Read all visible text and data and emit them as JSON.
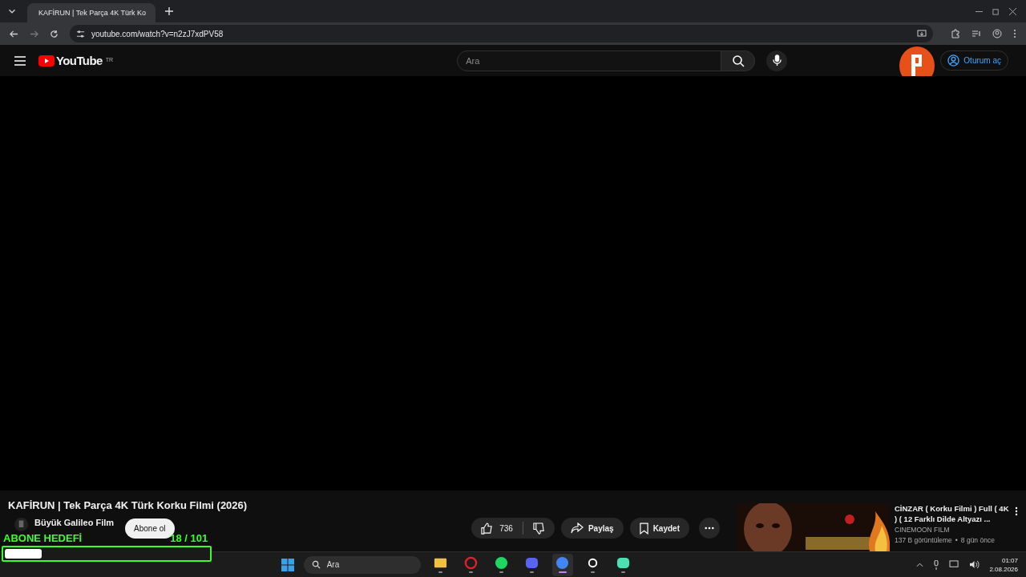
{
  "browser": {
    "tab_title": "KAFİRUN | Tek Parça 4K Türk Ko",
    "url": "youtube.com/watch?v=n2zJ7xdPV58"
  },
  "header": {
    "logo": "YouTube",
    "region": "TR",
    "search_placeholder": "Ara",
    "sign_in": "Oturum aç"
  },
  "video": {
    "title": "KAFİRUN | Tek Parça 4K Türk Korku Filmi (2026)",
    "channel": "Büyük Galileo Film",
    "subscribe": "Abone ol",
    "likes": "736",
    "share": "Paylaş",
    "save": "Kaydet"
  },
  "recommended": [
    {
      "title": "CİNZAR ( Korku Filmi ) Full ( 4K ) ( 12 Farklı Dilde Altyazı ...",
      "channel": "CINEMOON FILM",
      "views": "137 B görüntüleme",
      "separator": "•",
      "age": "8 gün önce"
    }
  ],
  "overlay": {
    "label": "ABONE HEDEFİ",
    "count": "18 / 101",
    "level": 0.18
  },
  "taskbar": {
    "search_placeholder": "Ara",
    "time": "01:07",
    "date": "2.08.2026",
    "apps": [
      {
        "kind": "files",
        "selected": false
      },
      {
        "kind": "opera",
        "selected": false
      },
      {
        "kind": "spotify",
        "selected": false
      },
      {
        "kind": "discord",
        "selected": false
      },
      {
        "kind": "chrome",
        "selected": true
      },
      {
        "kind": "steelseries",
        "selected": false
      },
      {
        "kind": "messenger",
        "selected": false
      }
    ]
  }
}
